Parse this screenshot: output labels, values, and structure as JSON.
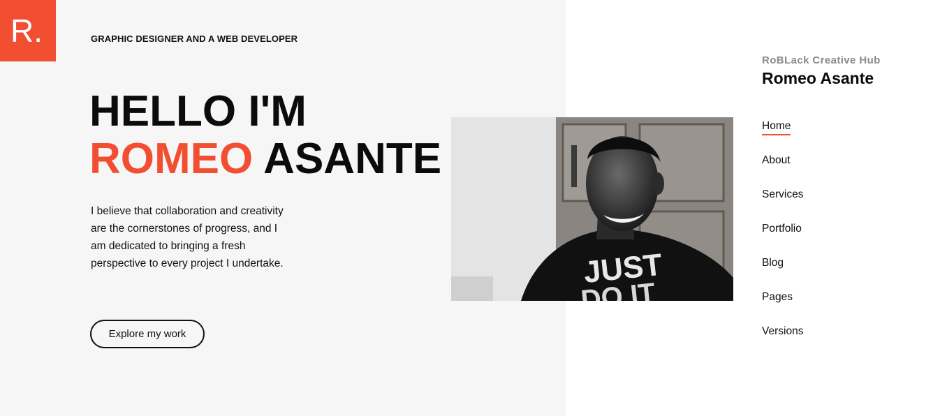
{
  "logo": {
    "text": "R."
  },
  "hero": {
    "tagline": "GRAPHIC DESIGNER AND A WEB DEVELOPER",
    "greeting": "HELLO I'M",
    "first_name": "ROMEO",
    "last_name": "ASANTE",
    "intro": "I believe that collaboration and creativity are the cornerstones of progress, and I am dedicated to bringing a fresh perspective to every project I undertake.",
    "cta_label": "Explore my work"
  },
  "sidebar": {
    "brand_sub": "RoBLack Creative Hub",
    "brand_name": "Romeo Asante",
    "nav": [
      {
        "label": "Home",
        "active": true
      },
      {
        "label": "About",
        "active": false
      },
      {
        "label": "Services",
        "active": false
      },
      {
        "label": "Portfolio",
        "active": false
      },
      {
        "label": "Blog",
        "active": false
      },
      {
        "label": "Pages",
        "active": false
      },
      {
        "label": "Versions",
        "active": false
      }
    ]
  },
  "colors": {
    "accent": "#f24e32",
    "panel": "#f6f6f6",
    "text": "#111111"
  }
}
